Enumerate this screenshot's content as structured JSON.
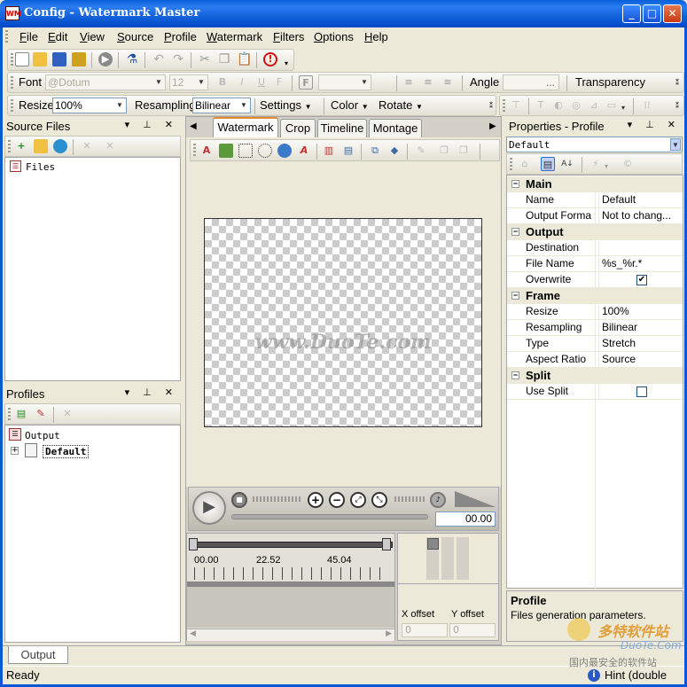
{
  "window": {
    "title": "Config - Watermark Master",
    "app_icon": "WM"
  },
  "menu": [
    "File",
    "Edit",
    "View",
    "Source",
    "Profile",
    "Watermark",
    "Filters",
    "Options",
    "Help"
  ],
  "font_toolbar": {
    "font_label": "Font",
    "font_value": "@Dotum",
    "size_value": "12",
    "angle_label": "Angle",
    "angle_btn": "...",
    "transparency_label": "Transparency"
  },
  "resample_toolbar": {
    "resize_label": "Resize",
    "resize_value": "100%",
    "resampling_label": "Resampling",
    "resampling_value": "Bilinear",
    "settings_label": "Settings",
    "color_label": "Color",
    "rotate_label": "Rotate"
  },
  "source_panel": {
    "title": "Source Files",
    "tree_root": "Files"
  },
  "profiles_panel": {
    "title": "Profiles",
    "root": "Output",
    "child": "Default"
  },
  "tabs": [
    "Watermark",
    "Crop",
    "Timeline",
    "Montage"
  ],
  "canvas": {
    "watermark": "www.DuoTe.com"
  },
  "player": {
    "time": "00.00"
  },
  "timeline": {
    "ticks": [
      "00.00",
      "22.52",
      "45.04"
    ]
  },
  "offsets": {
    "x_label": "X offset",
    "x_value": "0",
    "y_label": "Y offset",
    "y_value": "0"
  },
  "properties": {
    "title": "Properties - Profile",
    "selected": "Default",
    "categories": [
      {
        "name": "Main",
        "rows": [
          {
            "name": "Name",
            "value": "Default"
          },
          {
            "name": "Output Forma",
            "value": "Not to chang..."
          }
        ]
      },
      {
        "name": "Output",
        "rows": [
          {
            "name": "Destination",
            "value": ""
          },
          {
            "name": "File Name",
            "value": "%s_%r.*"
          },
          {
            "name": "Overwrite",
            "value": "checked"
          }
        ]
      },
      {
        "name": "Frame",
        "rows": [
          {
            "name": "Resize",
            "value": "100%"
          },
          {
            "name": "Resampling",
            "value": "Bilinear"
          },
          {
            "name": "Type",
            "value": "Stretch"
          },
          {
            "name": "Aspect Ratio",
            "value": "Source"
          }
        ]
      },
      {
        "name": "Split",
        "rows": [
          {
            "name": "Use Split",
            "value": "unchecked"
          }
        ]
      }
    ],
    "help_title": "Profile",
    "help_text": "Files generation parameters."
  },
  "bottom_tab": "Output",
  "status": {
    "text": "Ready",
    "hint": "Hint (double"
  },
  "overlay": {
    "brand_cn": "多特软件站",
    "brand_en": "DuoTe.Com",
    "slogan": "国内最安全的软件站"
  },
  "colors": {
    "titlebar": "#0b58d4",
    "accent": "#e68b2c"
  }
}
